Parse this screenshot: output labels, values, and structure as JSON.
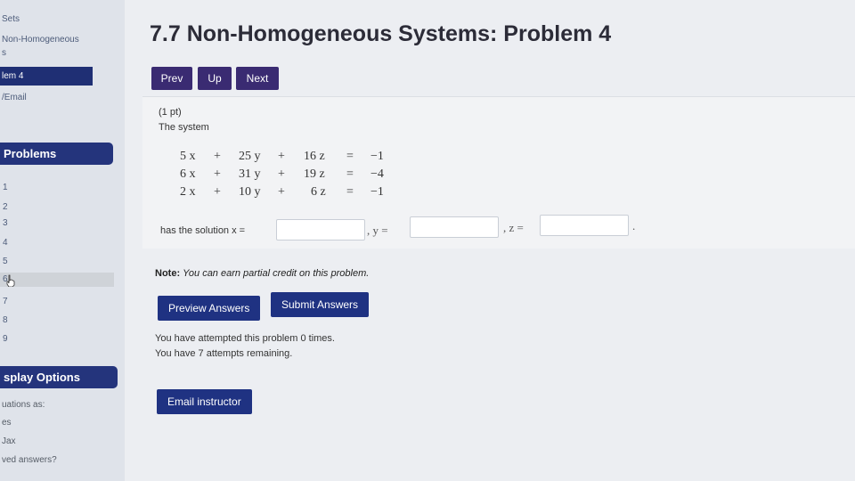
{
  "sidebar": {
    "links": [
      "Sets",
      "Non-Homogeneous",
      "s",
      "/Email"
    ],
    "current_problem": "lem 4",
    "problems_heading": "Problems",
    "problem_numbers": [
      "1",
      "2",
      "3",
      "4",
      "5",
      "6",
      "7",
      "8",
      "9"
    ],
    "display_options_heading": "splay Options",
    "options": [
      "uations as:",
      "es",
      "Jax",
      "ved answers?"
    ]
  },
  "header": {
    "title": "7.7 Non-Homogeneous Systems: Problem 4"
  },
  "nav": {
    "prev": "Prev",
    "up": "Up",
    "next": "Next"
  },
  "problem": {
    "points": "(1 pt)",
    "intro": "The system",
    "equations": [
      {
        "a": "5 x",
        "b": "25 y",
        "c": "16 z",
        "rhs": "−1"
      },
      {
        "a": "6 x",
        "b": "31 y",
        "c": "19 z",
        "rhs": "−4"
      },
      {
        "a": "2 x",
        "b": "10 y",
        "c": "6 z",
        "rhs": "−1"
      }
    ],
    "plus": "+",
    "equals": "=",
    "solution_prefix": "has the solution x =",
    "y_label": ", y =",
    "z_label": ", z =",
    "end_period": ".",
    "answers": {
      "x": "",
      "y": "",
      "z": ""
    }
  },
  "note": {
    "label": "Note:",
    "text": "You can earn partial credit on this problem."
  },
  "buttons": {
    "preview": "Preview Answers",
    "submit": "Submit Answers",
    "email": "Email instructor"
  },
  "attempts": {
    "line1": "You have attempted this problem 0 times.",
    "line2": "You have 7 attempts remaining."
  },
  "colors": {
    "nav_button": "#3a2b72",
    "action_button": "#1f3282",
    "sidebar_heading": "#24347c"
  }
}
